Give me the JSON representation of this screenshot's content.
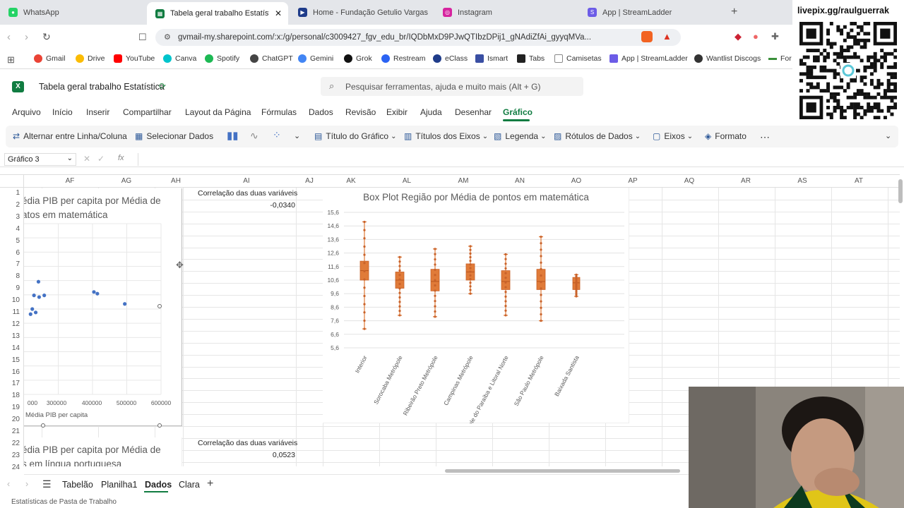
{
  "browser": {
    "tabs": [
      {
        "label": "WhatsApp",
        "color": "#25d366"
      },
      {
        "label": "Tabela geral trabalho Estatística",
        "color": "#107c41"
      },
      {
        "label": "Home - Fundação Getulio Vargas",
        "color": "#1f3c8a"
      },
      {
        "label": "Instagram",
        "color": "#d6249f"
      },
      {
        "label": "App | StreamLadder",
        "color": "#6c5ce7"
      }
    ],
    "url": "gvmail-my.sharepoint.com/:x:/g/personal/c3009427_fgv_edu_br/IQDbMxD9PJwQTIbzDPij1_gNAdiZfAi_gyyqMVa...",
    "bookmarks": [
      {
        "label": "Gmail",
        "color": "#ea4335"
      },
      {
        "label": "Drive",
        "color": "#fbbc04"
      },
      {
        "label": "YouTube",
        "color": "#ff0000"
      },
      {
        "label": "Canva",
        "color": "#00c4cc"
      },
      {
        "label": "Spotify",
        "color": "#1db954"
      },
      {
        "label": "ChatGPT",
        "color": "#444444"
      },
      {
        "label": "Gemini",
        "color": "#4285f4"
      },
      {
        "label": "Grok",
        "color": "#111111"
      },
      {
        "label": "Restream",
        "color": "#2b63f3"
      },
      {
        "label": "eClass",
        "color": "#1f3c8a"
      },
      {
        "label": "Ismart",
        "color": "#3a4fa3"
      },
      {
        "label": "Tabs",
        "color": "#222222"
      },
      {
        "label": "Camisetas",
        "color": "#888888"
      },
      {
        "label": "App | StreamLadder",
        "color": "#6c5ce7"
      },
      {
        "label": "Wantlist Discogs",
        "color": "#333333"
      },
      {
        "label": "For",
        "color": "#3a8f3a"
      }
    ]
  },
  "stream": {
    "overlay_text": "livepix.gg/raulguerrak"
  },
  "excel": {
    "file_title": "Tabela geral trabalho Estatística",
    "search_placeholder": "Pesquisar ferramentas, ajuda e muito mais (Alt + G)",
    "menu": [
      "Arquivo",
      "Início",
      "Inserir",
      "Compartilhar",
      "Layout da Página",
      "Fórmulas",
      "Dados",
      "Revisão",
      "Exibir",
      "Ajuda",
      "Desenhar",
      "Gráfico"
    ],
    "active_menu": "Gráfico",
    "ribbon": {
      "switch_row_col": "Alternar entre Linha/Coluna",
      "select_data": "Selecionar Dados",
      "chart_title": "Título do Gráfico",
      "axis_titles": "Títulos dos Eixos",
      "legend": "Legenda",
      "data_labels": "Rótulos de Dados",
      "axes": "Eixos",
      "format": "Formato"
    },
    "name_box": "Gráfico 3",
    "columns": [
      "AF",
      "AG",
      "AH",
      "AI",
      "AJ",
      "AK",
      "AL",
      "AM",
      "AN",
      "AO",
      "AP",
      "AQ",
      "AR",
      "AS",
      "AT"
    ],
    "rows": [
      "1",
      "2",
      "3",
      "4",
      "5",
      "6",
      "7",
      "8",
      "9",
      "10",
      "11",
      "12",
      "13",
      "14",
      "15",
      "16",
      "17",
      "18",
      "19",
      "20",
      "21",
      "22",
      "23",
      "24"
    ],
    "corr1_label": "Correlação das duas variáveis",
    "corr1_value": "-0,0340",
    "corr2_label": "Correlação das duas variáveis",
    "corr2_value": "0,0523",
    "sheet_tabs": [
      "Tabelão",
      "Planilha1",
      "Dados",
      "Clara"
    ],
    "active_sheet": "Dados",
    "status": "Estatísticas de Pasta de Trabalho"
  },
  "chart_data": [
    {
      "type": "scatter",
      "title": "édia PIB per capita por Média de\natos em matemática",
      "title_line1": "édia PIB per capita por Média de",
      "title_line2": "atos em matemática",
      "xlabel": "Média PIB per capita",
      "x_ticks": [
        "000",
        "300000",
        "400000",
        "500000",
        "600000"
      ],
      "y_ticks": [],
      "points_x": [
        215000,
        220000,
        225000,
        230000,
        238000,
        240000,
        255000,
        400000,
        410000,
        490000
      ],
      "points_y": [
        10.3,
        10.6,
        11.4,
        10.4,
        12.2,
        11.3,
        11.4,
        11.6,
        11.5,
        10.9
      ],
      "xlim": [
        200000,
        600000
      ],
      "ylim": [
        5.6,
        15.6
      ]
    },
    {
      "type": "box",
      "title": "Box Plot Região por Média de pontos em matemática",
      "y_ticks": [
        "15,6",
        "14,6",
        "13,6",
        "12,6",
        "11,6",
        "10,6",
        "9,6",
        "8,6",
        "7,6",
        "6,6",
        "5,6"
      ],
      "ylim": [
        5.6,
        15.6
      ],
      "color": "#e07b39",
      "categories": [
        "Interior",
        "Sorocaba Metrópole",
        "Ribeirão Preto Metrópole",
        "Campinas Metrópole",
        "Vale do Paraíba e Litoral Norte",
        "São Paulo Metrópole",
        "Baixada Santista"
      ],
      "boxes": [
        {
          "min": 7.0,
          "q1": 10.6,
          "median": 11.3,
          "q3": 12.0,
          "max": 14.9
        },
        {
          "min": 8.0,
          "q1": 10.0,
          "median": 10.6,
          "q3": 11.2,
          "max": 12.3
        },
        {
          "min": 7.9,
          "q1": 9.8,
          "median": 10.5,
          "q3": 11.4,
          "max": 12.9
        },
        {
          "min": 9.6,
          "q1": 10.6,
          "median": 11.2,
          "q3": 11.8,
          "max": 13.1
        },
        {
          "min": 8.0,
          "q1": 9.9,
          "median": 10.5,
          "q3": 11.3,
          "max": 12.5
        },
        {
          "min": 7.6,
          "q1": 9.9,
          "median": 10.5,
          "q3": 11.4,
          "max": 13.8
        },
        {
          "min": 9.4,
          "q1": 9.9,
          "median": 10.4,
          "q3": 10.8,
          "max": 11.0
        }
      ]
    }
  ]
}
